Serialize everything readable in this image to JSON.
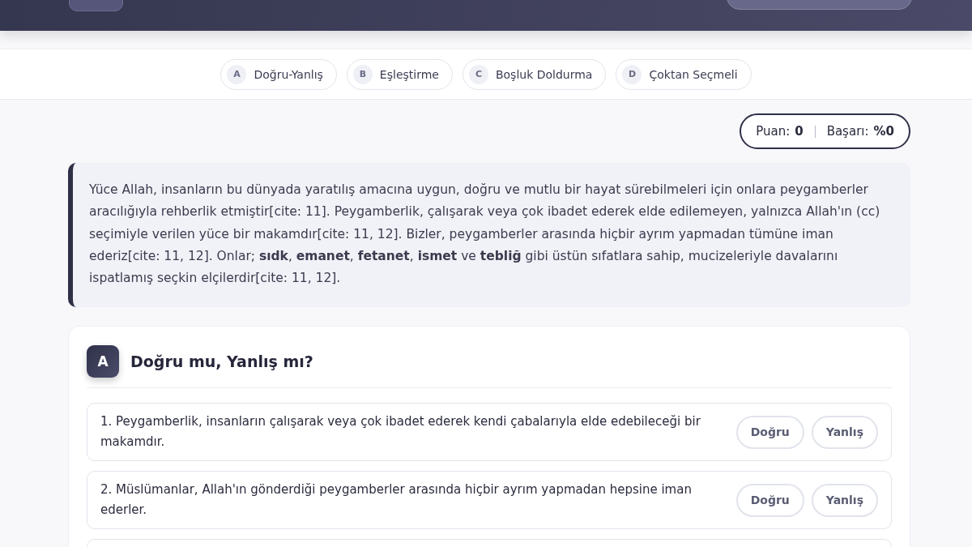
{
  "nav_tabs": [
    {
      "letter": "A",
      "label": "Doğru-Yanlış"
    },
    {
      "letter": "B",
      "label": "Eşleştirme"
    },
    {
      "letter": "C",
      "label": "Boşluk Doldurma"
    },
    {
      "letter": "D",
      "label": "Çoktan Seçmeli"
    }
  ],
  "score": {
    "points_label": "Puan:",
    "points": "0",
    "success_label": "Başarı:",
    "success": "%0"
  },
  "intro": "Yüce Allah, insanların bu dünyada yaratılış amacına uygun, doğru ve mutlu bir hayat sürebilmeleri için onlara peygamberler aracılığıyla rehberlik etmiştir[cite: 11]. Peygamberlik, çalışarak veya çok ibadet ederek elde edilemeyen, yalnızca Allah'ın (cc) seçimiyle verilen yüce bir makamdır[cite: 11, 12]. Bizler, peygamberler arasında hiçbir ayrım yapmadan tümüne iman ederiz[cite: 11, 12]. Onlar; **sıdk**, **emanet**, **fetanet**, **ismet** ve **tebliğ** gibi üstün sıfatlara sahip, mucizeleriyle davalarını ispatlamış seçkin elçilerdir[cite: 11, 12].",
  "section": {
    "letter": "A",
    "title": "Doğru mu, Yanlış mı?",
    "questions": [
      {
        "text": "1. Peygamberlik, insanların çalışarak veya çok ibadet ederek kendi çabalarıyla elde edebileceği bir makamdır.",
        "buttons": [
          "Doğru",
          "Yanlış"
        ]
      },
      {
        "text": "2. Müslümanlar, Allah'ın gönderdiği peygamberler arasında hiçbir ayrım yapmadan hepsine iman ederler.",
        "buttons": [
          "Doğru",
          "Yanlış"
        ]
      }
    ]
  }
}
